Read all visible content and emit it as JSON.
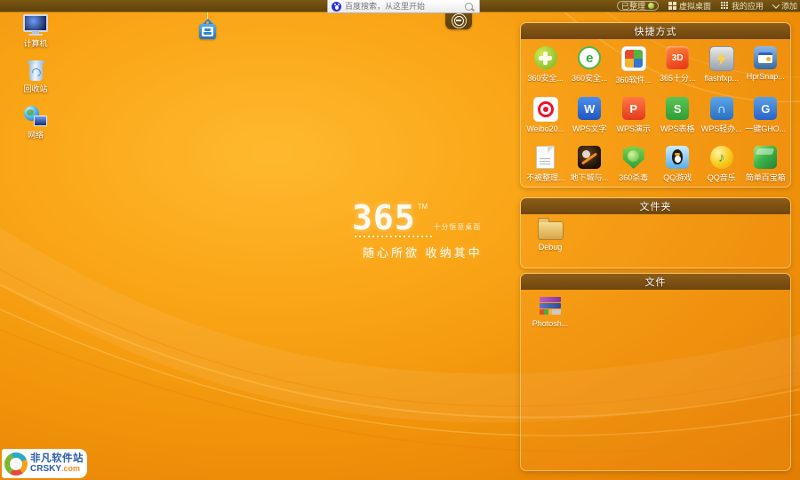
{
  "topbar": {
    "search_placeholder": "百度搜索，从这里开始",
    "organized_label": "已整理",
    "virtual_desktop_label": "虚拟桌面",
    "my_apps_label": "我的应用",
    "add_label": "添加"
  },
  "desktop_icons": [
    {
      "label": "计算机"
    },
    {
      "label": "回收站"
    },
    {
      "label": "网络"
    }
  ],
  "wallpaper": {
    "brand": "365",
    "trademark": "TM",
    "side_text": "十分惬意桌面",
    "slogan": "随心所欲 收纳其中"
  },
  "panels": {
    "shortcuts": {
      "title": "快捷方式",
      "items": [
        {
          "label": "360安全..."
        },
        {
          "label": "360安全...",
          "glyph": "e"
        },
        {
          "label": "360软件..."
        },
        {
          "label": "365十分...",
          "glyph": "3D"
        },
        {
          "label": "flashfxp..."
        },
        {
          "label": "HprSnap..."
        },
        {
          "label": "Weibo20..."
        },
        {
          "label": "WPS文字",
          "glyph": "W"
        },
        {
          "label": "WPS演示",
          "glyph": "P"
        },
        {
          "label": "WPS表格",
          "glyph": "S"
        },
        {
          "label": "WPS轻办...",
          "glyph": "∩"
        },
        {
          "label": "一键GHO...",
          "glyph": "G"
        },
        {
          "label": "不被整理..."
        },
        {
          "label": "地下城与..."
        },
        {
          "label": "360杀毒"
        },
        {
          "label": "QQ游戏"
        },
        {
          "label": "QQ音乐",
          "glyph": "♪"
        },
        {
          "label": "简单百宝箱"
        }
      ]
    },
    "folders": {
      "title": "文件夹",
      "items": [
        {
          "label": "Debug"
        }
      ]
    },
    "files": {
      "title": "文件",
      "items": [
        {
          "label": "Photosh..."
        }
      ]
    }
  },
  "watermark": {
    "site_name": "非凡软件站",
    "domain": "CRSKY",
    "tld": ".com"
  }
}
